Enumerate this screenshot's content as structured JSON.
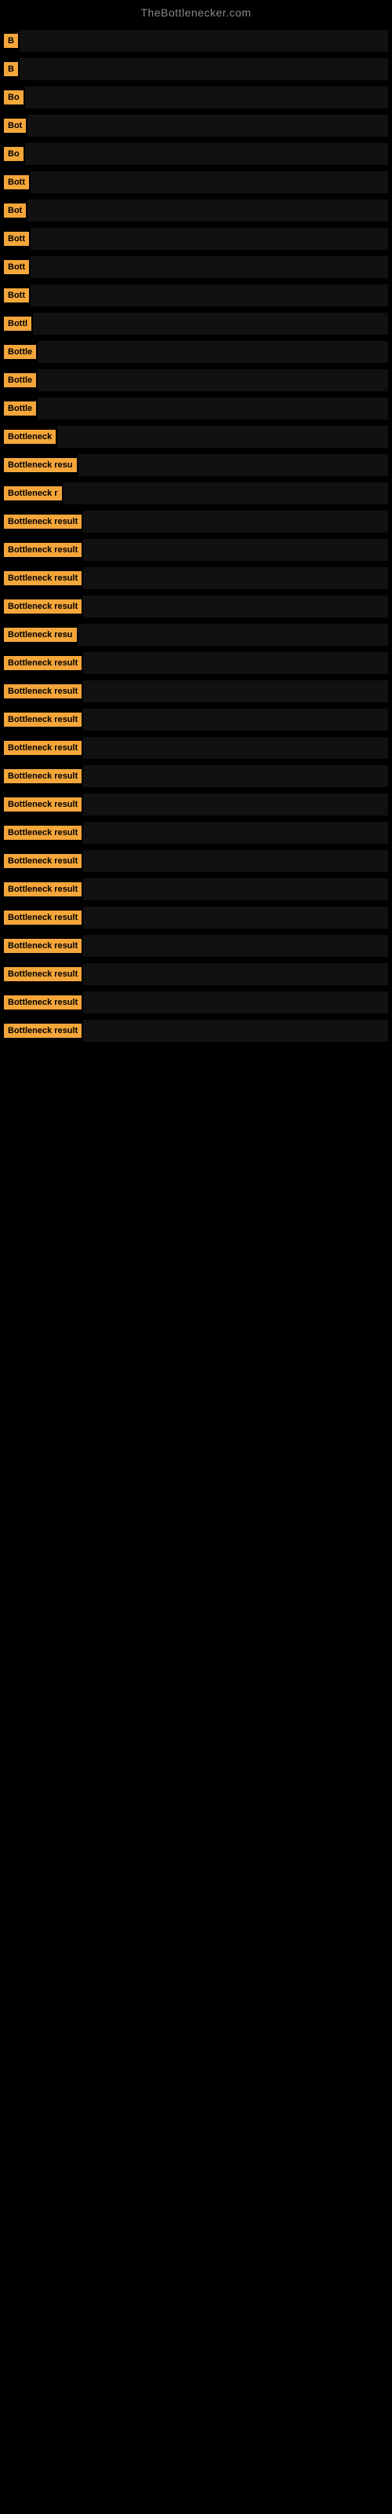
{
  "site": {
    "title": "TheBottlenecker.com"
  },
  "items": [
    {
      "label": "B",
      "barWidth": 440
    },
    {
      "label": "B",
      "barWidth": 430
    },
    {
      "label": "Bo",
      "barWidth": 420
    },
    {
      "label": "Bot",
      "barWidth": 410
    },
    {
      "label": "Bo",
      "barWidth": 400
    },
    {
      "label": "Bott",
      "barWidth": 390
    },
    {
      "label": "Bot",
      "barWidth": 380
    },
    {
      "label": "Bott",
      "barWidth": 370
    },
    {
      "label": "Bott",
      "barWidth": 360
    },
    {
      "label": "Bott",
      "barWidth": 350
    },
    {
      "label": "Bottl",
      "barWidth": 340
    },
    {
      "label": "Bottle",
      "barWidth": 330
    },
    {
      "label": "Bottle",
      "barWidth": 320
    },
    {
      "label": "Bottle",
      "barWidth": 310
    },
    {
      "label": "Bottleneck",
      "barWidth": 300
    },
    {
      "label": "Bottleneck resu",
      "barWidth": 285
    },
    {
      "label": "Bottleneck r",
      "barWidth": 275
    },
    {
      "label": "Bottleneck result",
      "barWidth": 265
    },
    {
      "label": "Bottleneck result",
      "barWidth": 255
    },
    {
      "label": "Bottleneck result",
      "barWidth": 245
    },
    {
      "label": "Bottleneck result",
      "barWidth": 235
    },
    {
      "label": "Bottleneck resu",
      "barWidth": 225
    },
    {
      "label": "Bottleneck result",
      "barWidth": 215
    },
    {
      "label": "Bottleneck result",
      "barWidth": 205
    },
    {
      "label": "Bottleneck result",
      "barWidth": 195
    },
    {
      "label": "Bottleneck result",
      "barWidth": 185
    },
    {
      "label": "Bottleneck result",
      "barWidth": 175
    },
    {
      "label": "Bottleneck result",
      "barWidth": 165
    },
    {
      "label": "Bottleneck result",
      "barWidth": 155
    },
    {
      "label": "Bottleneck result",
      "barWidth": 145
    },
    {
      "label": "Bottleneck result",
      "barWidth": 135
    },
    {
      "label": "Bottleneck result",
      "barWidth": 125
    },
    {
      "label": "Bottleneck result",
      "barWidth": 115
    },
    {
      "label": "Bottleneck result",
      "barWidth": 105
    },
    {
      "label": "Bottleneck result",
      "barWidth": 95
    },
    {
      "label": "Bottleneck result",
      "barWidth": 85
    }
  ]
}
